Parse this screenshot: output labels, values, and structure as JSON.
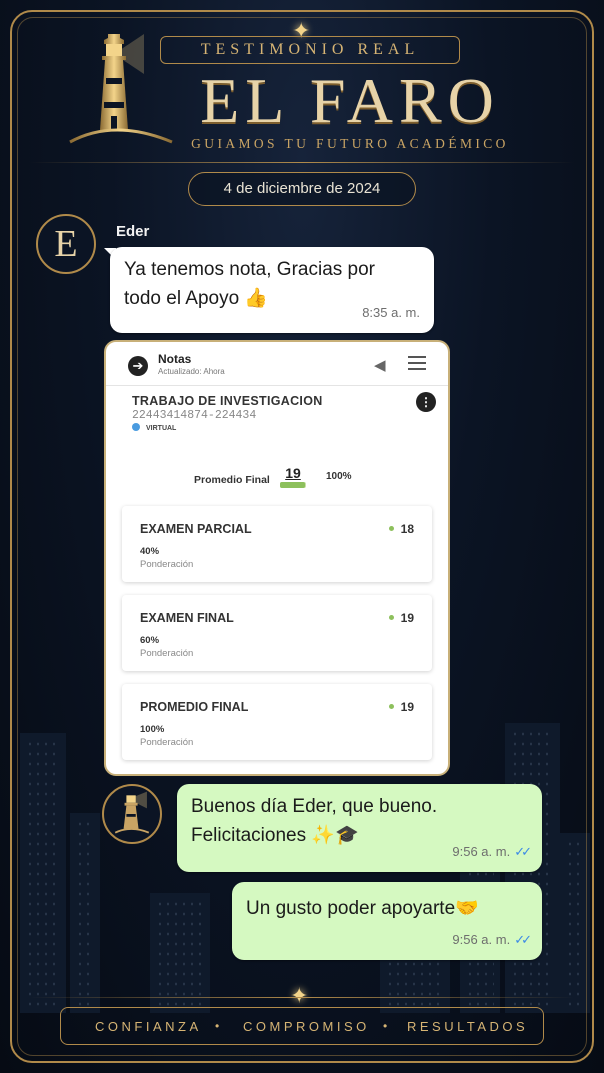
{
  "header": {
    "tag": "TESTIMONIO REAL",
    "brand": "EL FARO",
    "tagline": "GUIAMOS TU FUTURO ACADÉMICO"
  },
  "date_label": "4 de diciembre de 2024",
  "messages": [
    {
      "sender": "Eder",
      "avatar_letter": "E",
      "lines": [
        "Ya tenemos nota, Gracias por",
        "todo el Apoyo 👍"
      ],
      "time": "8:35 a. m."
    },
    {
      "lines": [
        "Buenos día Eder, que bueno.",
        "Felicitaciones ✨🎓"
      ],
      "time": "9:56 a. m."
    },
    {
      "lines": [
        "Un gusto poder apoyarte🤝"
      ],
      "time": "9:56 a. m."
    }
  ],
  "screenshot": {
    "title": "Notas",
    "subtitle": "Actualizado: Ahora",
    "course": "TRABAJO DE INVESTIGACION",
    "code": "22443414874-224434",
    "mode": "VIRTUAL",
    "final_label": "Promedio Final",
    "final_grade": "19",
    "final_pct": "100%",
    "final_fill": 0.95,
    "grades": [
      {
        "name": "EXAMEN PARCIAL",
        "value": "18",
        "pct": "40%",
        "pond": "Ponderación"
      },
      {
        "name": "EXAMEN FINAL",
        "value": "19",
        "pct": "60%",
        "pond": "Ponderación"
      },
      {
        "name": "PROMEDIO FINAL",
        "value": "19",
        "pct": "100%",
        "pond": "Ponderación"
      }
    ]
  },
  "footer": {
    "items": [
      "CONFIANZA",
      "COMPROMISO",
      "RESULTADOS"
    ],
    "separator": "•"
  },
  "colors": {
    "gold": "#b08a4a",
    "background": "#0a1220",
    "bubble_in": "#ffffff",
    "bubble_out": "#d5f9c1",
    "read_ticks": "#3c8ae6"
  },
  "icons": [
    "lighthouse-icon",
    "back-arrow-icon",
    "megaphone-icon",
    "menu-icon",
    "more-icon",
    "read-check-icon",
    "sparkle-icon"
  ]
}
